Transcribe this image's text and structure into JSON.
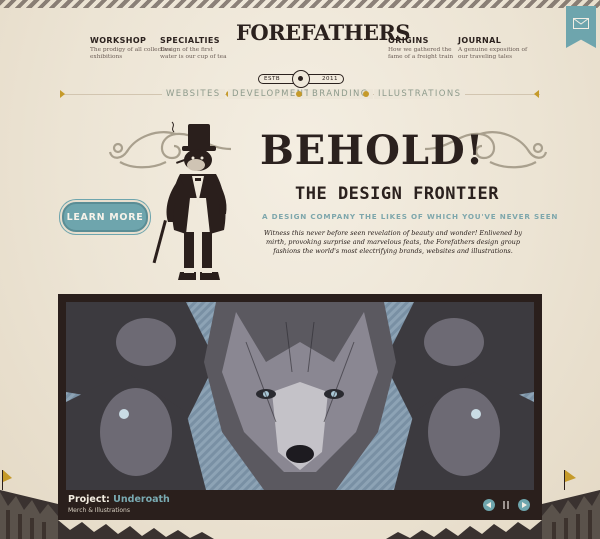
{
  "logo": {
    "wordmark": "FOREFATHERS",
    "estb": "ESTB",
    "year": "2011"
  },
  "top_nav": [
    {
      "title": "WORKSHOP",
      "desc": "The prodigy of all collective exhibitions"
    },
    {
      "title": "SPECIALTIES",
      "desc": "Design of the first water is our cup of tea"
    },
    {
      "title": "ORIGINS",
      "desc": "How we gathered the fame of a freight train"
    },
    {
      "title": "JOURNAL",
      "desc": "A genuine exposition of our traveling tales"
    }
  ],
  "sub_nav": [
    "WEBSITES",
    "DEVELOPMENT",
    "BRANDING",
    "ILLUSTRATIONS"
  ],
  "hero": {
    "headline": "BEHOLD!",
    "subheadline": "THE DESIGN FRONTIER",
    "tagline": "A DESIGN COMPANY THE LIKES OF WHICH YOU'VE NEVER SEEN",
    "description": "Witness this never before seen revelation of beauty and wonder! Enlivened by mirth, provoking surprise and marvelous feats, the Forefathers design group fashions the world's most electrifying brands, websites and illustrations.",
    "cta": "LEARN MORE"
  },
  "showcase": {
    "project_prefix": "Project:",
    "project_name": "Underoath",
    "project_category": "Merch & Illustrations"
  },
  "colors": {
    "accent": "#6ea5ad",
    "ink": "#2b211e",
    "paper": "#efe8da",
    "gold": "#c59a2a"
  },
  "icons": [
    "envelope-icon",
    "arrow-left-icon",
    "pause-icon",
    "arrow-right-icon"
  ]
}
